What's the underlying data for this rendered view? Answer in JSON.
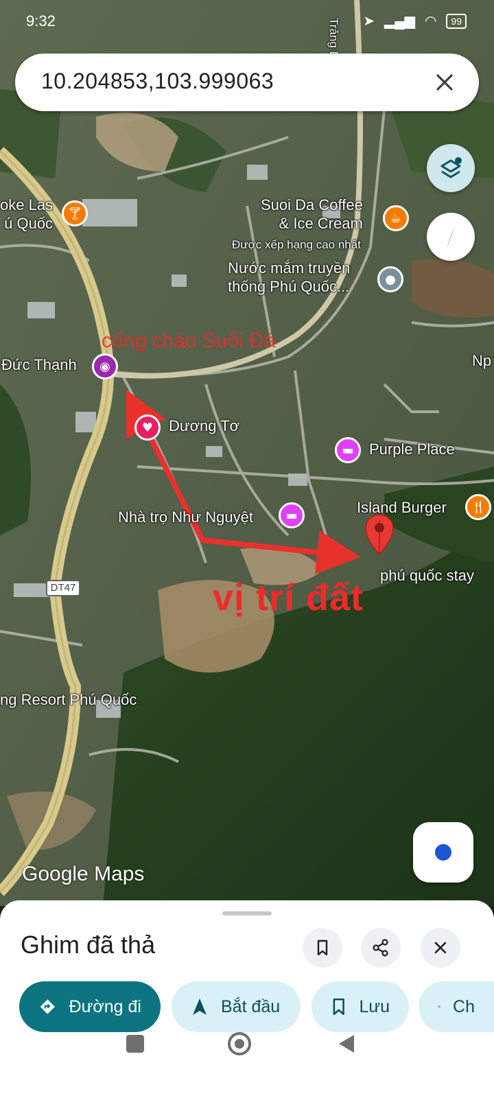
{
  "status_bar": {
    "time": "9:32",
    "battery": "99"
  },
  "search": {
    "query": "10.204853,103.999063",
    "close_icon": "close-icon"
  },
  "map": {
    "pois": {
      "karaoke": {
        "line1": "oke Las",
        "line2": "ú Quốc",
        "icon": "cocktail-icon",
        "color": "#f57c00"
      },
      "suoi_da_coffee": {
        "line1": "Suoi Da Coffee",
        "line2": "& Ice Cream",
        "sub": "Được xếp hạng cao nhất",
        "icon": "coffee-icon",
        "color": "#f57c00"
      },
      "nuoc_mam": {
        "line1": "Nước mắm truyền",
        "line2": "thống Phú Quốc...",
        "icon": "place-icon",
        "color": "#78909c"
      },
      "duc_thanh": {
        "label": "Đức Thạnh",
        "icon": "camera-icon",
        "color": "#9c27b0"
      },
      "np": {
        "label": "Np"
      },
      "duong_to": {
        "label": "Dương Tơ",
        "icon": "heart-icon",
        "color": "#e91e63"
      },
      "purple_place": {
        "label": "Purple Place",
        "icon": "bed-icon",
        "color": "#e040fb"
      },
      "island_burger": {
        "label": "Island Burger",
        "icon": "restaurant-icon",
        "color": "#f57c00"
      },
      "nha_tro": {
        "label": "Nhà trọ Như Nguyệt",
        "icon": "bed-icon",
        "color": "#e040fb"
      },
      "phu_quoc_stay": {
        "label": "phú quốc stay"
      },
      "resort": {
        "label": "ng Resort Phú Quốc"
      },
      "road_shield": {
        "label": "DT47"
      },
      "trang_road": {
        "label": "Trảng Dư"
      }
    },
    "annotations": {
      "gate": "cổng chào Suối Đá",
      "land": "vị trí đất"
    },
    "pin_color": "#e53935",
    "arrow_color": "#e8312b",
    "watermark": "Google Maps"
  },
  "sheet": {
    "title": "Ghim đã thả",
    "actions": [
      {
        "label": "Đường đi",
        "icon": "directions-icon"
      },
      {
        "label": "Bắt đầu",
        "icon": "navigation-icon"
      },
      {
        "label": "Lưu",
        "icon": "bookmark-icon"
      },
      {
        "label": "Ch",
        "icon": "share-icon"
      }
    ]
  }
}
